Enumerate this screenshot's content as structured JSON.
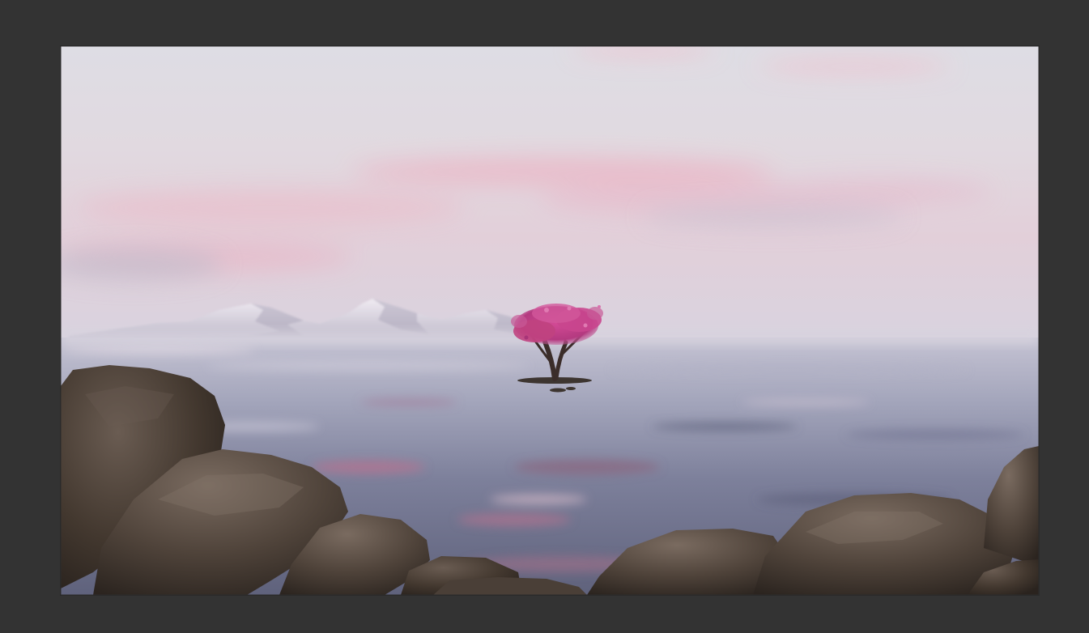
{
  "window": {
    "background_color": "#333333"
  },
  "render_view": {
    "scene_elements": [
      "pastel-sky",
      "distant-mountains",
      "calm-sea",
      "pink-blossom-tree",
      "foreground-rocks"
    ],
    "colors": {
      "sky_top": "#dcdbe3",
      "sky_pink": "#e7c4d0",
      "mountain": "#d6d2de",
      "sea_light": "#b9b9cc",
      "sea_dark": "#6c6f89",
      "blossom": "#c23a86",
      "rock": "#4b4038"
    }
  }
}
